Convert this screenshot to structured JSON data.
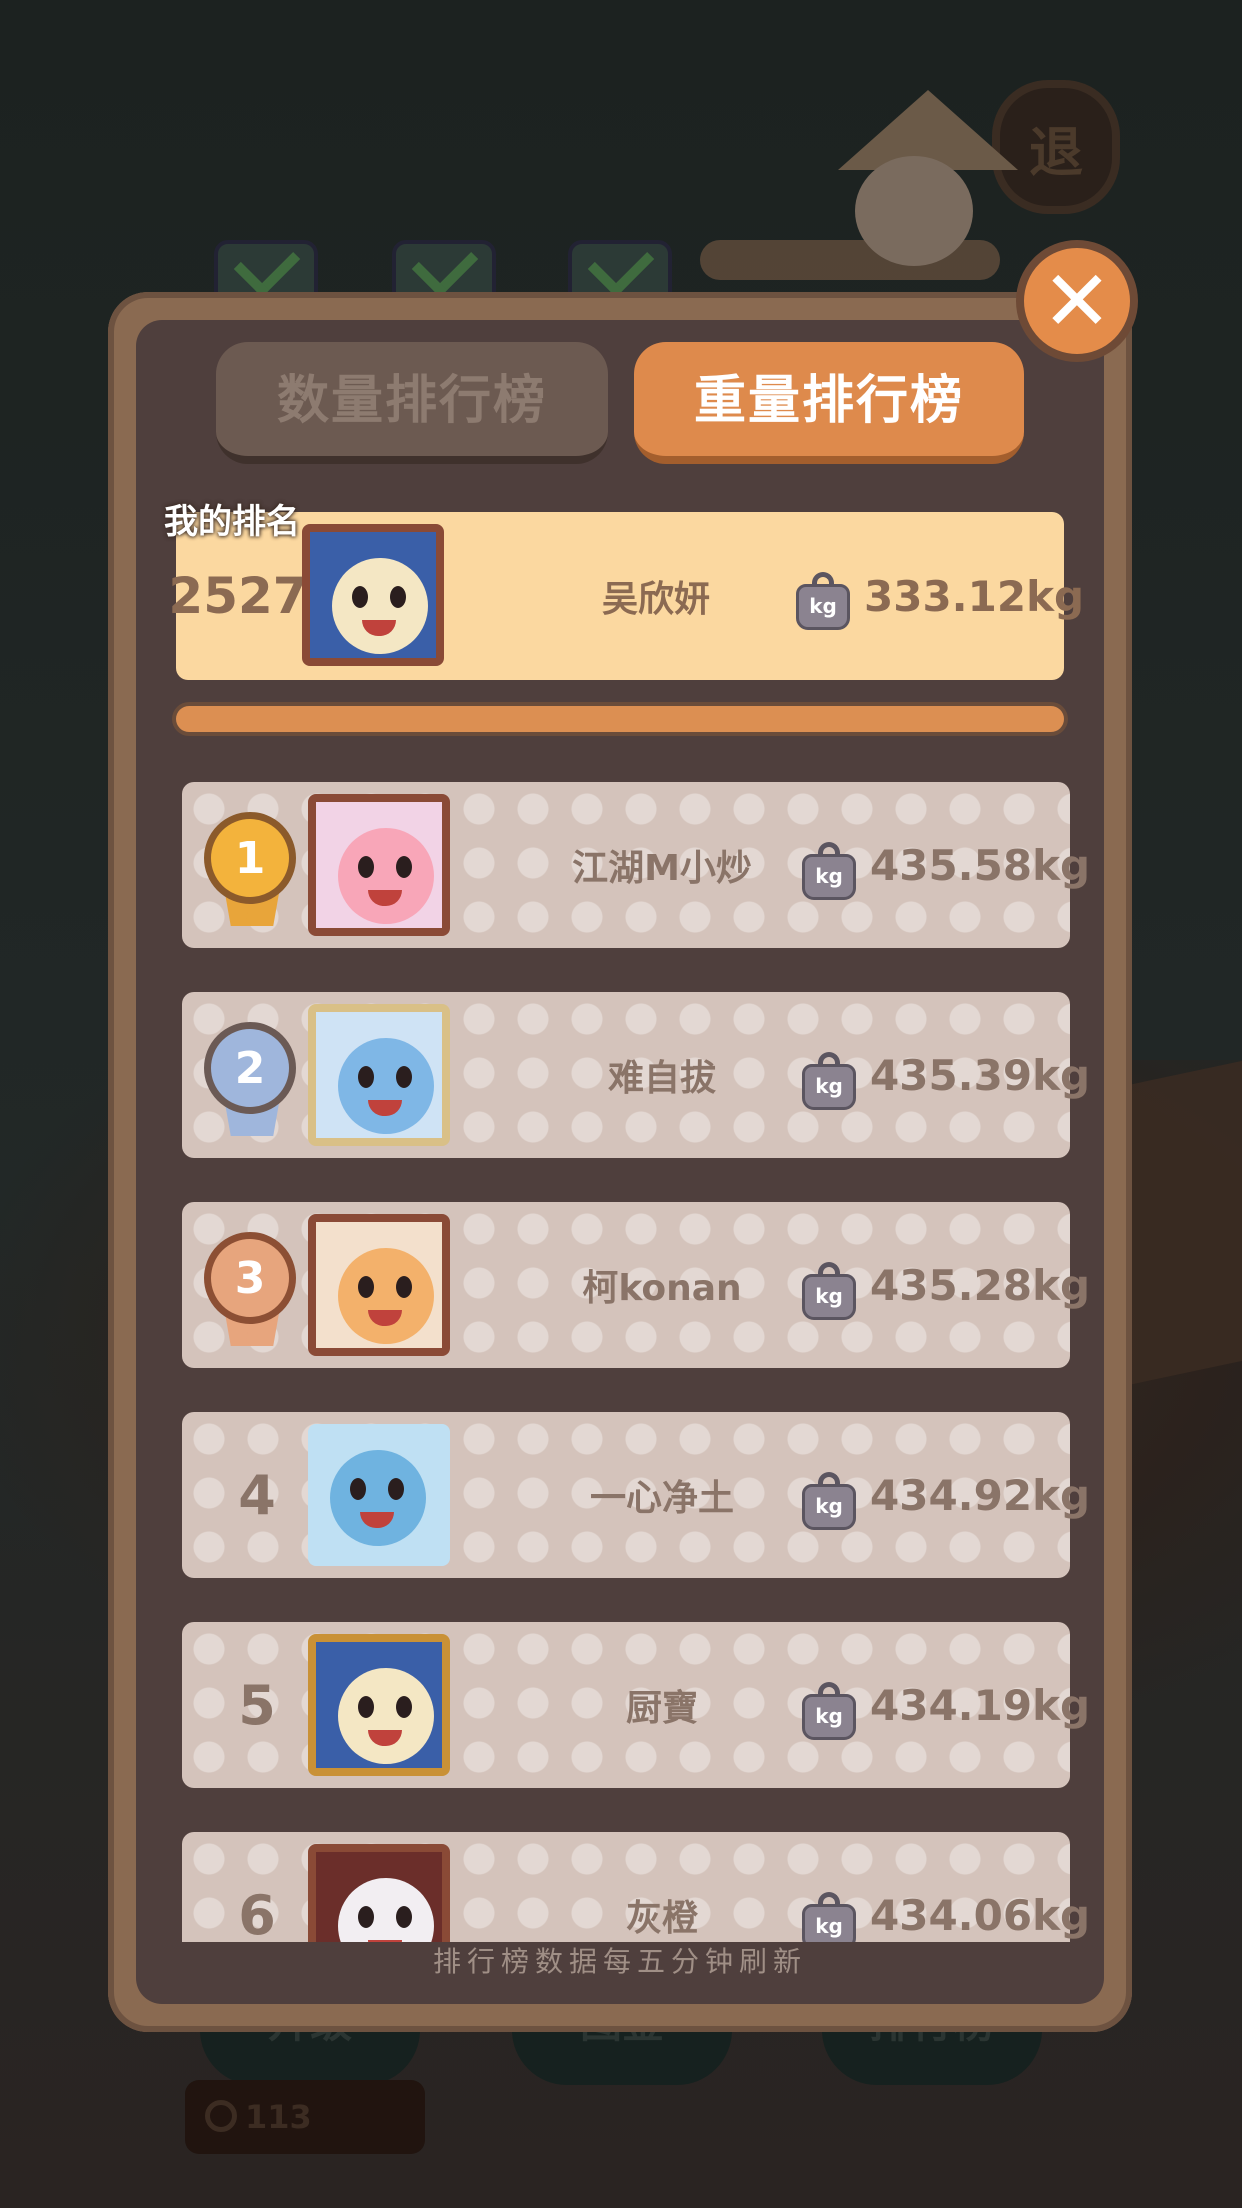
{
  "background": {
    "exit_label": "退",
    "bottom_buttons": [
      "升级",
      "图鉴",
      "排行榜"
    ],
    "coin_count": "113"
  },
  "tabs": {
    "count_label": "数量排行榜",
    "weight_label": "重量排行榜",
    "active": "weight"
  },
  "close_icon": "close-icon",
  "my_rank": {
    "label": "我的排名",
    "rank": "2527",
    "name": "吴欣妍",
    "weight": "333.12kg"
  },
  "leaderboard": [
    {
      "rank": "1",
      "medal": "gold",
      "name": "江湖M小炒",
      "weight": "435.58kg"
    },
    {
      "rank": "2",
      "medal": "silver",
      "name": "难自拔",
      "weight": "435.39kg"
    },
    {
      "rank": "3",
      "medal": "bronze",
      "name": "柯konan",
      "weight": "435.28kg"
    },
    {
      "rank": "4",
      "medal": "",
      "name": "一心净土",
      "weight": "434.92kg"
    },
    {
      "rank": "5",
      "medal": "",
      "name": "厨寶",
      "weight": "434.19kg"
    },
    {
      "rank": "6",
      "medal": "",
      "name": "灰橙",
      "weight": "434.06kg"
    }
  ],
  "weight_icon_label": "kg",
  "footer_note": "排行榜数据每五分钟刷新",
  "colors": {
    "accent": "#de8a4c",
    "panel": "#4f3f3d",
    "row": "#d4c3bb",
    "my_row": "#fbd8a0"
  }
}
